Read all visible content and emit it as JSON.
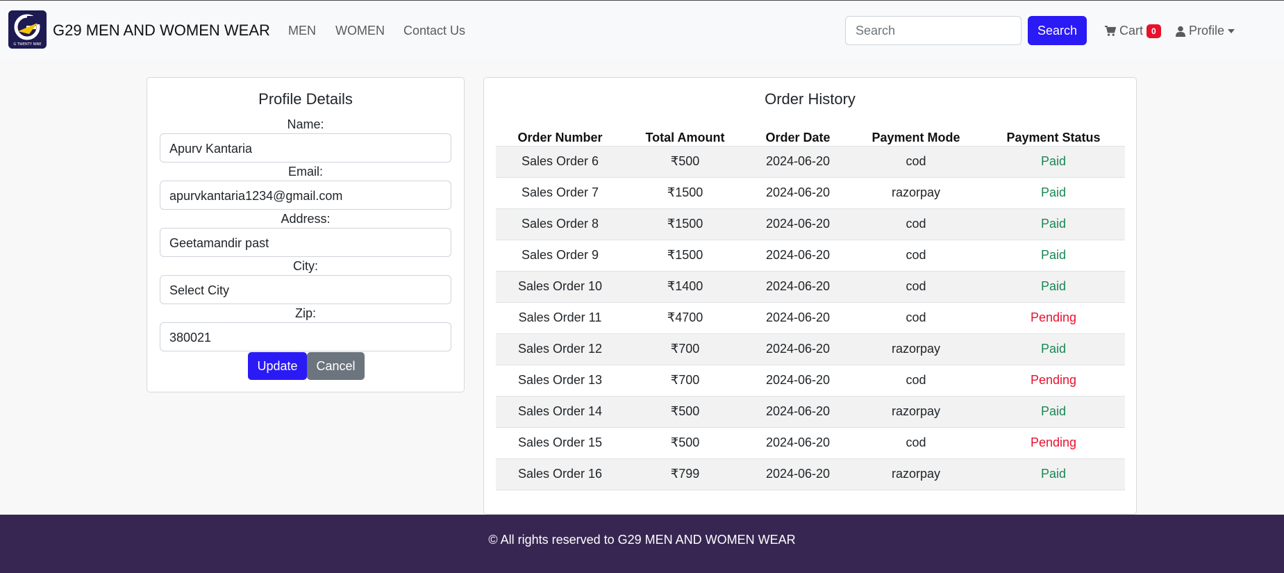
{
  "brand": {
    "name": "G29 MEN AND WOMEN WEAR",
    "logo_text": "G TWENTY NINE"
  },
  "nav": [
    {
      "label": "MEN"
    },
    {
      "label": "WOMEN"
    },
    {
      "label": "Contact Us"
    }
  ],
  "search": {
    "placeholder": "Search",
    "button_label": "Search"
  },
  "cart": {
    "label": "Cart",
    "count": "0"
  },
  "profile_menu": {
    "label": "Profile"
  },
  "profile_details": {
    "title": "Profile Details",
    "fields": [
      {
        "label": "Name:",
        "value": "Apurv Kantaria"
      },
      {
        "label": "Email:",
        "value": "apurvkantaria1234@gmail.com"
      },
      {
        "label": "Address:",
        "value": "Geetamandir past"
      },
      {
        "label": "City:",
        "value": "Select City"
      },
      {
        "label": "Zip:",
        "value": "380021"
      }
    ],
    "update_label": "Update",
    "cancel_label": "Cancel"
  },
  "order_history": {
    "title": "Order History",
    "columns": [
      "Order Number",
      "Total Amount",
      "Order Date",
      "Payment Mode",
      "Payment Status"
    ],
    "rows": [
      {
        "number": "Sales Order 6",
        "amount": "₹500",
        "date": "2024-06-20",
        "mode": "cod",
        "status": "Paid"
      },
      {
        "number": "Sales Order 7",
        "amount": "₹1500",
        "date": "2024-06-20",
        "mode": "razorpay",
        "status": "Paid"
      },
      {
        "number": "Sales Order 8",
        "amount": "₹1500",
        "date": "2024-06-20",
        "mode": "cod",
        "status": "Paid"
      },
      {
        "number": "Sales Order 9",
        "amount": "₹1500",
        "date": "2024-06-20",
        "mode": "cod",
        "status": "Paid"
      },
      {
        "number": "Sales Order 10",
        "amount": "₹1400",
        "date": "2024-06-20",
        "mode": "cod",
        "status": "Paid"
      },
      {
        "number": "Sales Order 11",
        "amount": "₹4700",
        "date": "2024-06-20",
        "mode": "cod",
        "status": "Pending"
      },
      {
        "number": "Sales Order 12",
        "amount": "₹700",
        "date": "2024-06-20",
        "mode": "razorpay",
        "status": "Paid"
      },
      {
        "number": "Sales Order 13",
        "amount": "₹700",
        "date": "2024-06-20",
        "mode": "cod",
        "status": "Pending"
      },
      {
        "number": "Sales Order 14",
        "amount": "₹500",
        "date": "2024-06-20",
        "mode": "razorpay",
        "status": "Paid"
      },
      {
        "number": "Sales Order 15",
        "amount": "₹500",
        "date": "2024-06-20",
        "mode": "cod",
        "status": "Pending"
      },
      {
        "number": "Sales Order 16",
        "amount": "₹799",
        "date": "2024-06-20",
        "mode": "razorpay",
        "status": "Paid"
      }
    ]
  },
  "footer": {
    "text": "© All rights reserved to G29 MEN AND WOMEN WEAR"
  },
  "colors": {
    "primary": "#2a1af5",
    "secondary": "#6c757d",
    "footer_bg": "#372651",
    "paid": "#198754",
    "pending": "#e8112d",
    "badge": "#e8112d"
  }
}
